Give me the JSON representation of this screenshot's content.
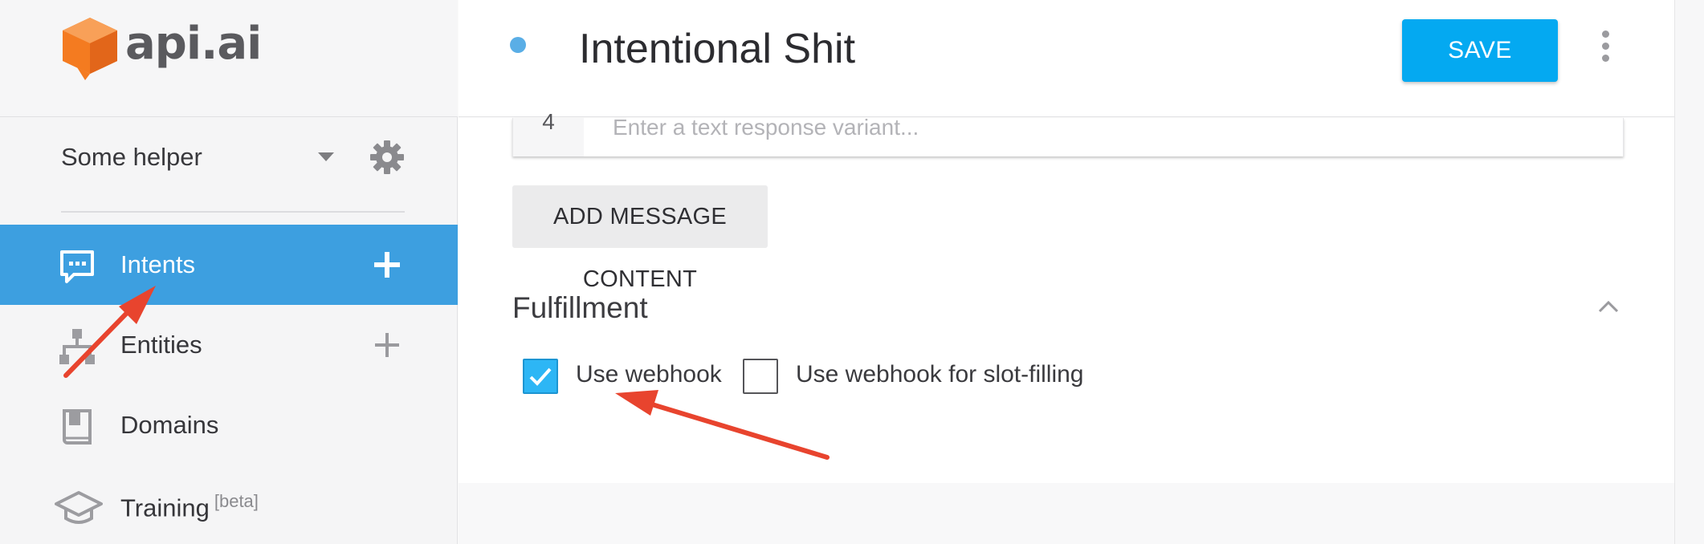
{
  "brand": {
    "name": "api.ai",
    "logo_color": "#f47b20",
    "accent": "#3d9fe0",
    "save_color": "#04a9f1",
    "annotation_color": "#e8442e"
  },
  "sidebar": {
    "agent": {
      "name": "Some helper",
      "dropdown_icon": "caret-down-icon",
      "settings_icon": "gear-icon"
    },
    "items": [
      {
        "label": "Intents",
        "icon": "chat-bubble-icon",
        "active": true,
        "has_add": true
      },
      {
        "label": "Entities",
        "icon": "hierarchy-icon",
        "active": false,
        "has_add": true
      },
      {
        "label": "Domains",
        "icon": "book-icon",
        "active": false,
        "has_add": false
      },
      {
        "label": "Training",
        "icon": "graduation-cap-icon",
        "active": false,
        "has_add": false,
        "badge": "[beta]"
      }
    ]
  },
  "header": {
    "title": "Intentional Shit",
    "save_label": "SAVE",
    "more_icon": "more-vertical-icon"
  },
  "main": {
    "response_row": {
      "number": "4",
      "placeholder": "Enter a text response variant..."
    },
    "add_message_label": "ADD MESSAGE CONTENT",
    "fulfillment": {
      "title": "Fulfillment",
      "collapse_icon": "chevron-up-icon",
      "options": [
        {
          "label": "Use webhook",
          "checked": true
        },
        {
          "label": "Use webhook for slot-filling",
          "checked": false
        }
      ]
    }
  }
}
